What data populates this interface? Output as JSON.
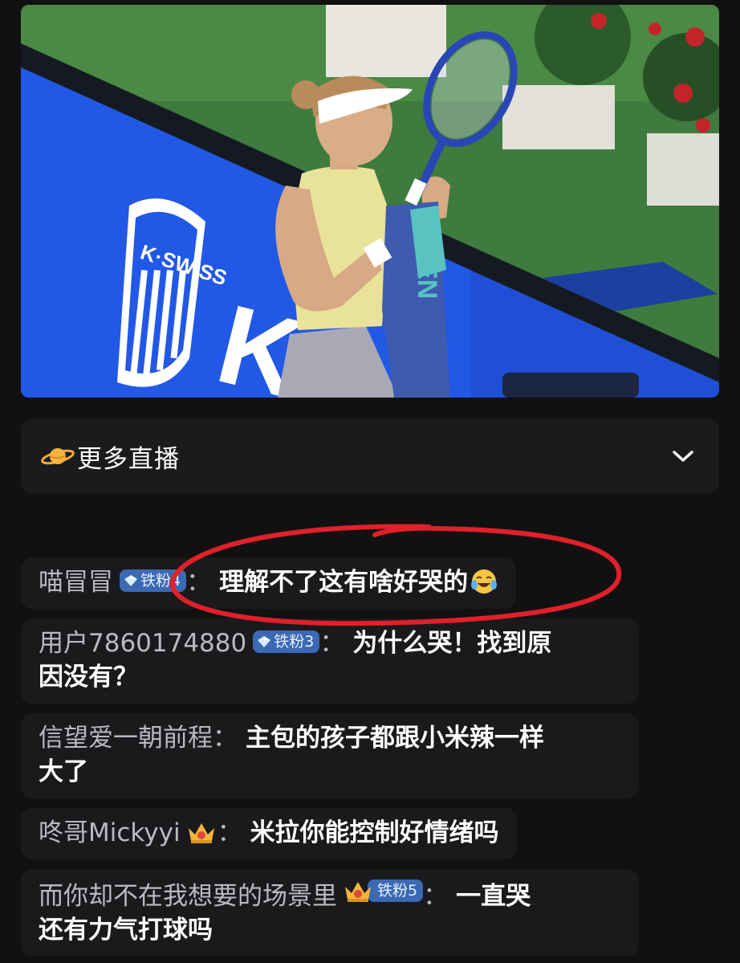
{
  "video": {
    "banner_brand": "K·SWISS",
    "towel_text": "OPEN"
  },
  "more_live": {
    "label": "更多直播",
    "icon": "planet-icon",
    "expand_icon": "chevron-down-icon"
  },
  "chat": {
    "messages": [
      {
        "user": "喵冒冒",
        "badge": "铁粉4",
        "text": "理解不了这有啥好哭的",
        "emoji": "crying-laughing-emoji"
      },
      {
        "user": "用户7860174880",
        "badge": "铁粉3",
        "text_line1": "为什么哭！找到原",
        "text_line2": "因没有？"
      },
      {
        "user": "信望爱一朝前程",
        "text_line1": "主包的孩子都跟小米辣一样",
        "text_line2": "大了"
      },
      {
        "user": "咚哥Mickyyi",
        "badge_icon": "crown-icon",
        "text": "米拉你能控制好情绪吗"
      },
      {
        "user": "而你却不在我想要的场景里",
        "badge": "铁粉5",
        "badge_icon": "crown-icon",
        "text_line1": "一直哭",
        "text_line2": "还有力气打球吗"
      }
    ],
    "colon": "："
  },
  "colors": {
    "background": "#111111",
    "card": "#1b1b1e",
    "badge_blue": "#3b69b3",
    "annotation_red": "#e0202a"
  }
}
